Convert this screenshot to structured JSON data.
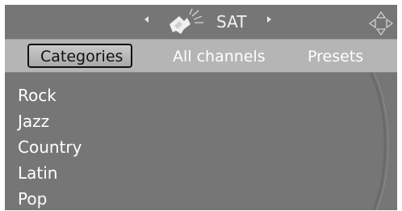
{
  "header": {
    "title": "SAT",
    "prev_icon": "chevron-left-icon",
    "next_icon": "chevron-right-icon",
    "source_icon": "satellite-icon",
    "controller_icon": "dpad-icon"
  },
  "tabs": [
    {
      "label": "Categories",
      "selected": true
    },
    {
      "label": "All channels",
      "selected": false
    },
    {
      "label": "Presets",
      "selected": false
    }
  ],
  "list": {
    "items": [
      "Rock",
      "Jazz",
      "Country",
      "Latin",
      "Pop"
    ]
  },
  "colors": {
    "screen_bg": "#767676",
    "tabbar_bg": "#b5b5b5",
    "text": "#ffffff",
    "selected_text": "#111111"
  }
}
